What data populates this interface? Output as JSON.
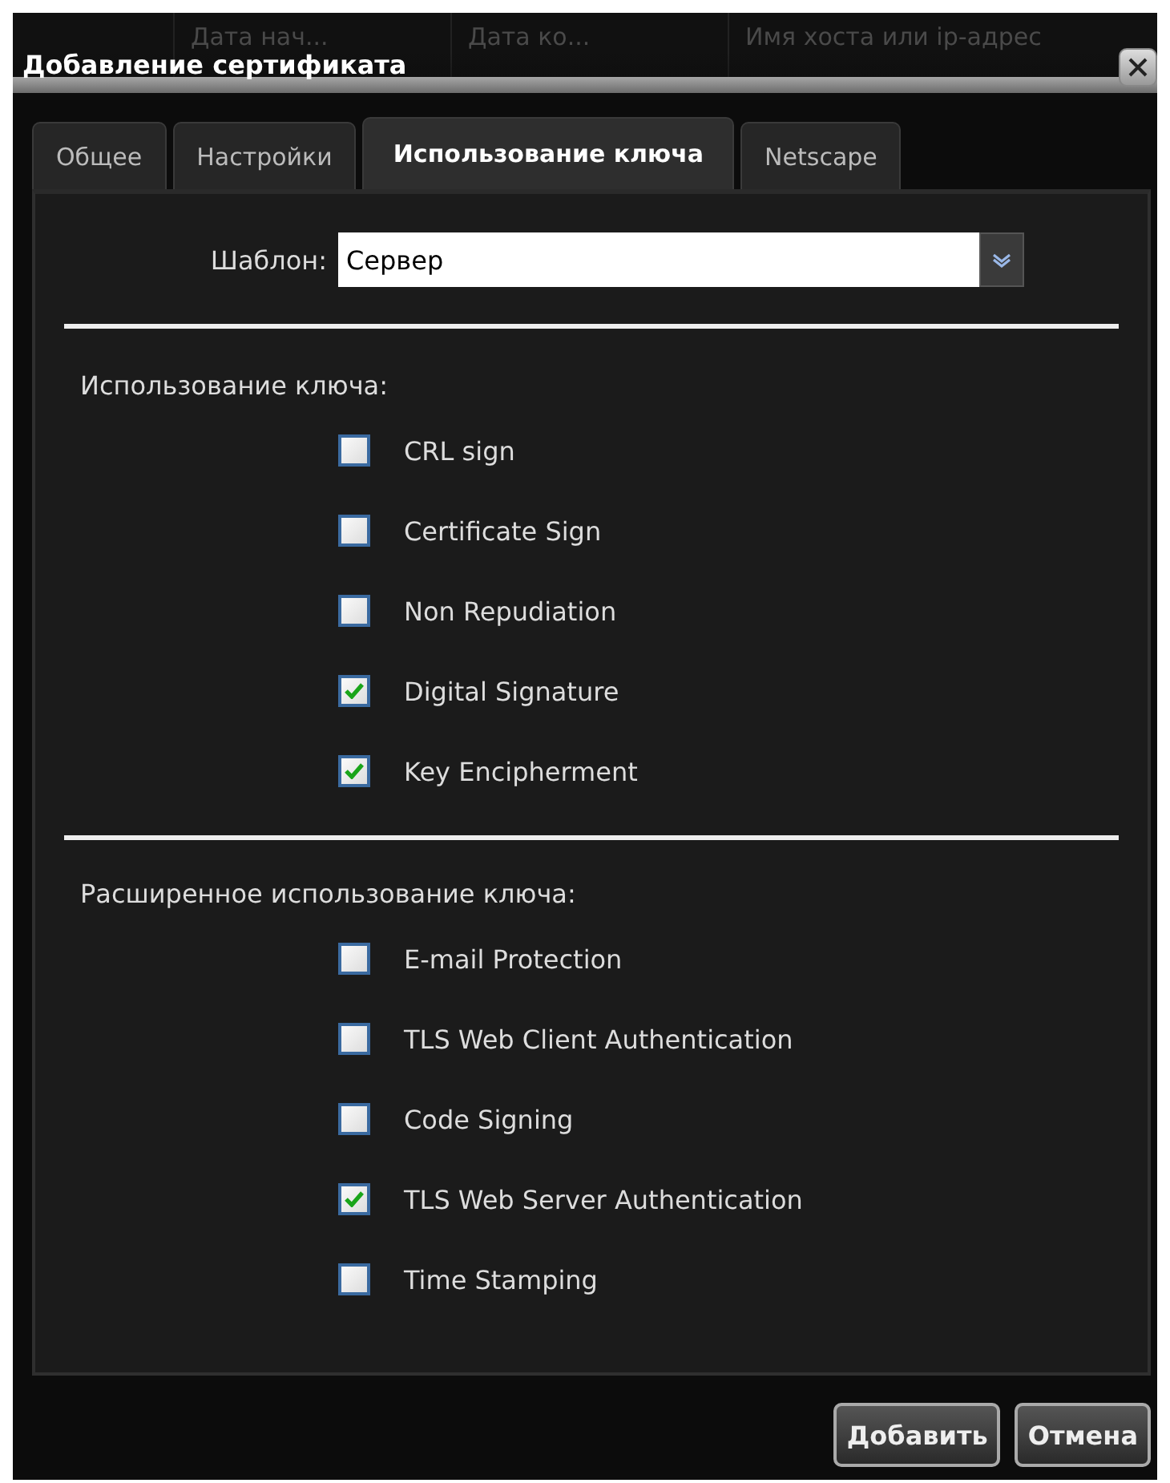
{
  "background_table": {
    "columns": [
      "Дата нач...",
      "Дата ко...",
      "Имя хоста или ip-адрес"
    ]
  },
  "window": {
    "title": "Добавление сертификата"
  },
  "tabs": [
    {
      "label": "Общее",
      "selected": false
    },
    {
      "label": "Настройки",
      "selected": false
    },
    {
      "label": "Использование ключа",
      "selected": true
    },
    {
      "label": "Netscape",
      "selected": false
    }
  ],
  "template": {
    "label": "Шаблон:",
    "value": "Сервер"
  },
  "sections": [
    {
      "title": "Использование ключа:",
      "options": [
        {
          "label": "CRL sign",
          "checked": false
        },
        {
          "label": "Certificate Sign",
          "checked": false
        },
        {
          "label": "Non Repudiation",
          "checked": false
        },
        {
          "label": "Digital Signature",
          "checked": true
        },
        {
          "label": "Key Encipherment",
          "checked": true
        }
      ]
    },
    {
      "title": "Расширенное использование ключа:",
      "options": [
        {
          "label": "E-mail Protection",
          "checked": false
        },
        {
          "label": "TLS Web Client Authentication",
          "checked": false
        },
        {
          "label": "Code Signing",
          "checked": false
        },
        {
          "label": "TLS Web Server Authentication",
          "checked": true
        },
        {
          "label": "Time Stamping",
          "checked": false
        }
      ]
    }
  ],
  "buttons": [
    "Добавить",
    "Отмена"
  ]
}
